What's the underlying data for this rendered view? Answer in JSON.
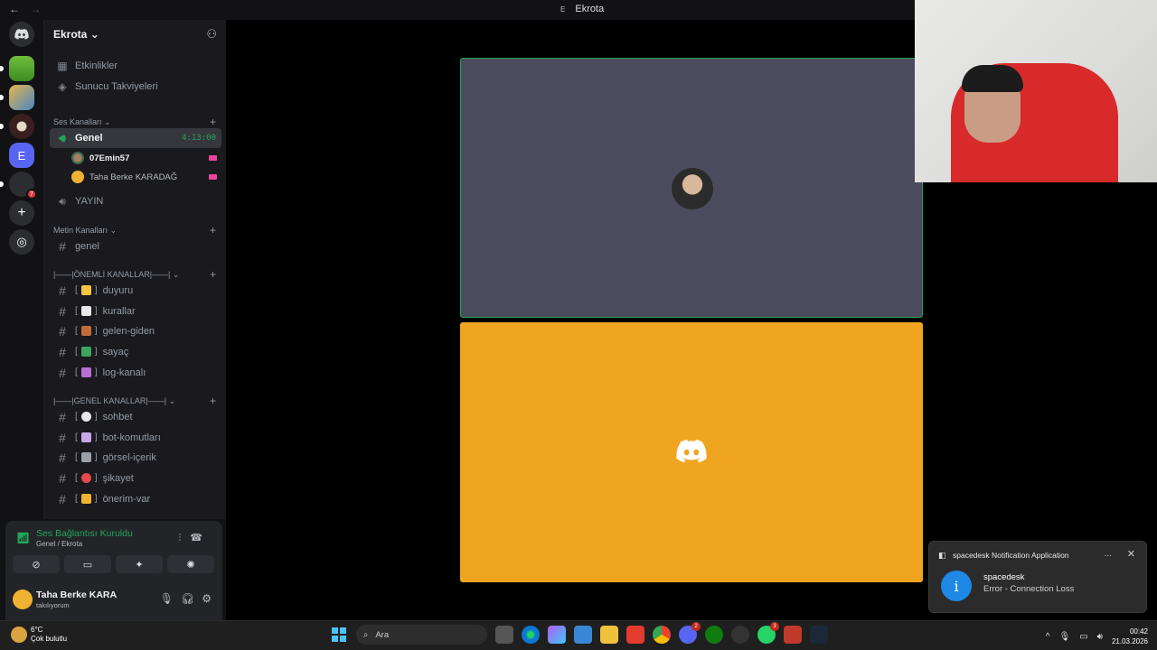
{
  "window": {
    "title": "Ekrota",
    "title_tag": "E"
  },
  "nav": {
    "back": "←",
    "forward": "→"
  },
  "server": {
    "name": "Ekrota",
    "chevron": "⌄"
  },
  "top_links": [
    {
      "label": "Etkinlikler",
      "icon": "calendar-icon"
    },
    {
      "label": "Sunucu Takviyeleri",
      "icon": "boost-icon"
    }
  ],
  "voice_category": {
    "label": "Ses Kanalları"
  },
  "voice_channels": [
    {
      "label": "Genel",
      "timer": "4:13:00"
    },
    {
      "label": "YAYIN"
    }
  ],
  "voice_users": [
    {
      "name": "07Emin57",
      "bold": true
    },
    {
      "name": "Taha Berke KARADAĞ"
    }
  ],
  "text_category": {
    "label": "Metin Kanalları"
  },
  "text_channels": [
    {
      "label": "genel"
    }
  ],
  "important_category": {
    "label": "|——|ÖNEMLİ KANALLAR|——|"
  },
  "important_channels": [
    {
      "label": "duyuru",
      "emoji_color": "#f5c542"
    },
    {
      "label": "kurallar",
      "emoji_color": "#e8e8e8"
    },
    {
      "label": "gelen-giden",
      "emoji_color": "#c26b3a"
    },
    {
      "label": "sayaç",
      "emoji_color": "#3ba55c"
    },
    {
      "label": "log-kanalı",
      "emoji_color": "#b86fd4"
    }
  ],
  "general_category": {
    "label": "|——|GENEL KANALLAR|——|"
  },
  "general_channels": [
    {
      "label": "sohbet",
      "emoji_color": "#e8e8e8"
    },
    {
      "label": "bot-komutları",
      "emoji_color": "#c9a6e8"
    },
    {
      "label": "görsel-içerik",
      "emoji_color": "#9aa0a6"
    },
    {
      "label": "şikayet",
      "emoji_color": "#e5484d"
    },
    {
      "label": "önerim-var",
      "emoji_color": "#f0b232"
    }
  ],
  "voice_panel": {
    "status": "Ses Bağlantısı Kuruldu",
    "sub": "Genel / Ekrota"
  },
  "user_area": {
    "name": "Taha Berke KARA...",
    "status": "takılıyorum"
  },
  "notification": {
    "app": "spacedesk Notification Application",
    "title": "spacedesk",
    "body": "Error - Connection Loss",
    "more": "...",
    "close": "✕",
    "info_glyph": "i"
  },
  "taskbar": {
    "weather_temp": "6°C",
    "weather_desc": "Çok bulutlu",
    "search_placeholder": "Ara",
    "time": "00:42",
    "date": "21.03.2026"
  },
  "guild_badge": "7",
  "taskbar_badges": {
    "discord": "2",
    "whatsapp": "3"
  },
  "colors": {
    "accent_green": "#23a55a",
    "tile_orange": "#f0a521",
    "tile_gray": "#4c4b5d"
  }
}
